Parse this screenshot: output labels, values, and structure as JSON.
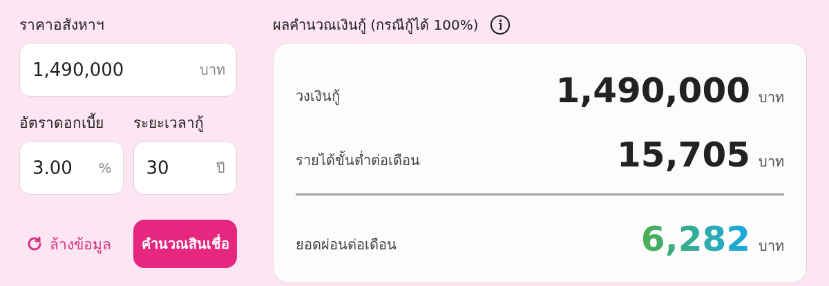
{
  "inputs": {
    "price": {
      "label": "ราคาอสังหาฯ",
      "value": "1,490,000",
      "unit": "บาท"
    },
    "rate": {
      "label": "อัตราดอกเบี้ย",
      "value": "3.00",
      "unit": "%"
    },
    "term": {
      "label": "ระยะเวลากู้",
      "value": "30",
      "unit": "ปี"
    }
  },
  "actions": {
    "reset": "ล้างข้อมูล",
    "calculate": "คำนวณสินเชื่อ"
  },
  "result": {
    "title": "ผลคำนวณเงินกู้ (กรณีกู้ได้ 100%)",
    "rows": [
      {
        "kind": "plain",
        "label": "วงเงินกู้",
        "value": "1,490,000",
        "unit": "บาท"
      },
      {
        "kind": "plain",
        "label": "รายได้ขั้นต่ำต่อเดือน",
        "value": "15,705",
        "unit": "บาท"
      },
      {
        "kind": "highlight",
        "label": "ยอดผ่อนต่อเดือน",
        "value": "6,282",
        "unit": "บาท"
      }
    ]
  }
}
